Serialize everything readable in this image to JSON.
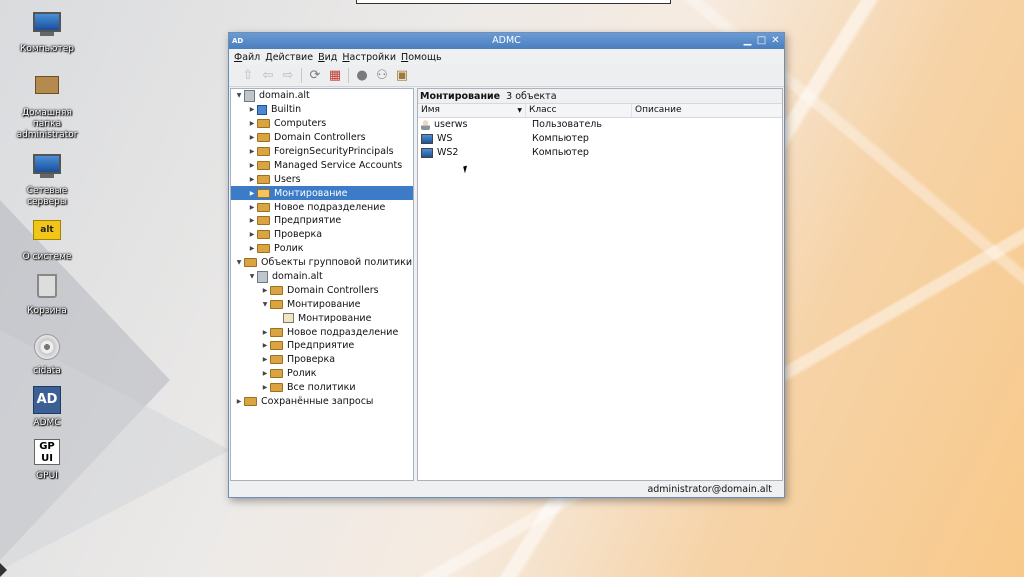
{
  "desktop": {
    "icons": [
      {
        "label": "Компьютер",
        "icon": "computer-icon"
      },
      {
        "label": "Домашняя папка administrator",
        "icon": "home-folder-icon"
      },
      {
        "label": "Сетевые серверы",
        "icon": "network-servers-icon"
      },
      {
        "label": "О системе",
        "icon": "basealt-about-icon"
      },
      {
        "label": "Корзина",
        "icon": "trash-icon"
      },
      {
        "label": "cidata",
        "icon": "cd-icon"
      },
      {
        "label": "ADMC",
        "icon": "admc-icon",
        "glyph": "AD"
      },
      {
        "label": "GPUI",
        "icon": "gpui-icon",
        "glyph": "GP UI"
      }
    ],
    "basealt_glyph": "alt"
  },
  "window": {
    "title": "ADMC",
    "app_icon": "AD",
    "menu": [
      "Файл",
      "Действие",
      "Вид",
      "Настройки",
      "Помощь"
    ],
    "tree": [
      {
        "label": "domain.alt",
        "level": 0,
        "icon": "domain",
        "expanded": true
      },
      {
        "label": "Builtin",
        "level": 1,
        "icon": "builtin"
      },
      {
        "label": "Computers",
        "level": 1,
        "icon": "folder"
      },
      {
        "label": "Domain Controllers",
        "level": 1,
        "icon": "folder"
      },
      {
        "label": "ForeignSecurityPrincipals",
        "level": 1,
        "icon": "folder"
      },
      {
        "label": "Managed Service Accounts",
        "level": 1,
        "icon": "folder"
      },
      {
        "label": "Users",
        "level": 1,
        "icon": "folder"
      },
      {
        "label": "Монтирование",
        "level": 1,
        "icon": "folder",
        "selected": true
      },
      {
        "label": "Новое подразделение",
        "level": 1,
        "icon": "folder"
      },
      {
        "label": "Предприятие",
        "level": 1,
        "icon": "folder"
      },
      {
        "label": "Проверка",
        "level": 1,
        "icon": "folder"
      },
      {
        "label": "Ролик",
        "level": 1,
        "icon": "folder"
      },
      {
        "label": "Объекты групповой политики",
        "level": 0,
        "icon": "folder",
        "expanded": true
      },
      {
        "label": "domain.alt",
        "level": 1,
        "icon": "domain",
        "expanded": true
      },
      {
        "label": "Domain Controllers",
        "level": 2,
        "icon": "folder"
      },
      {
        "label": "Монтирование",
        "level": 2,
        "icon": "folder",
        "expanded": true
      },
      {
        "label": "Монтирование",
        "level": 3,
        "icon": "gpo",
        "leaf": true
      },
      {
        "label": "Новое подразделение",
        "level": 2,
        "icon": "folder"
      },
      {
        "label": "Предприятие",
        "level": 2,
        "icon": "folder"
      },
      {
        "label": "Проверка",
        "level": 2,
        "icon": "folder"
      },
      {
        "label": "Ролик",
        "level": 2,
        "icon": "folder"
      },
      {
        "label": "Все политики",
        "level": 2,
        "icon": "folder"
      },
      {
        "label": "Сохранённые запросы",
        "level": 0,
        "icon": "folder"
      }
    ],
    "content": {
      "title": "Монтирование",
      "count": "3 объекта",
      "columns": [
        "Имя",
        "Класс",
        "Описание"
      ],
      "rows": [
        {
          "name": "userws",
          "class": "Пользователь",
          "description": "",
          "icon": "user"
        },
        {
          "name": "WS",
          "class": "Компьютер",
          "description": "",
          "icon": "computer"
        },
        {
          "name": "WS2",
          "class": "Компьютер",
          "description": "",
          "icon": "computer"
        }
      ]
    },
    "status": "administrator@domain.alt"
  }
}
